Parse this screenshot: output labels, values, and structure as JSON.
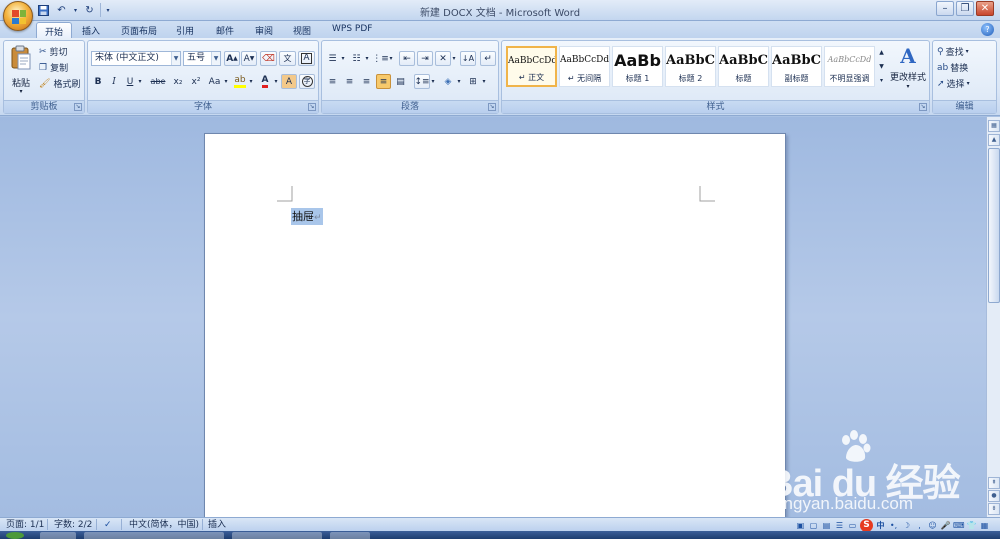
{
  "window": {
    "title": "新建 DOCX 文档 - Microsoft Word",
    "controls": {
      "minimize": "–",
      "restore": "❐",
      "close": "✕"
    }
  },
  "qat": {
    "save_icon": "save-icon",
    "undo_icon": "undo-icon",
    "redo_icon": "redo-icon"
  },
  "tabs": [
    {
      "label": "开始",
      "active": true
    },
    {
      "label": "插入"
    },
    {
      "label": "页面布局"
    },
    {
      "label": "引用"
    },
    {
      "label": "邮件"
    },
    {
      "label": "审阅"
    },
    {
      "label": "视图"
    },
    {
      "label": "WPS PDF"
    }
  ],
  "ribbon": {
    "clipboard": {
      "label": "剪贴板",
      "paste": "粘贴",
      "cut": "剪切",
      "copy": "复制",
      "format_painter": "格式刷"
    },
    "font": {
      "label": "字体",
      "font_name": "宋体 (中文正文)",
      "font_size": "五号",
      "grow": "A",
      "shrink": "A",
      "bold": "B",
      "italic": "I",
      "underline": "U",
      "strikethrough": "abe",
      "subscript": "x₂",
      "superscript": "x²",
      "change_case": "Aa",
      "font_color_letter": "A",
      "char_shading": "A"
    },
    "paragraph": {
      "label": "段落"
    },
    "styles": {
      "label": "样式",
      "items": [
        {
          "sample": "AaBbCcDd",
          "name": "↵ 正文",
          "selected": true
        },
        {
          "sample": "AaBbCcDd",
          "name": "↵ 无间隔"
        },
        {
          "sample": "AaBb",
          "name": "标题 1"
        },
        {
          "sample": "AaBbC",
          "name": "标题 2"
        },
        {
          "sample": "AaBbC",
          "name": "标题"
        },
        {
          "sample": "AaBbC",
          "name": "副标题"
        },
        {
          "sample": "AaBbCcDd",
          "name": "不明显强调"
        }
      ],
      "change_styles": "更改样式"
    },
    "editing": {
      "label": "编辑",
      "find": "查找",
      "replace": "替换",
      "select": "选择"
    }
  },
  "document": {
    "selected_text": "抽屉",
    "paragraph_mark": "↵"
  },
  "status": {
    "page": "页面: 1/1",
    "words": "字数: 2/2",
    "language": "中文(简体，中国)",
    "mode": "插入"
  },
  "ime": {
    "logo": "S",
    "lang": "中"
  },
  "watermark": {
    "brand": "Bai du 经验",
    "url": "jingyan.baidu.com"
  },
  "colors": {
    "accent": "#f0b44a",
    "selection": "#a9c6ea",
    "ribbon": "#dae6f6",
    "workspace": "#a9c1e3"
  }
}
